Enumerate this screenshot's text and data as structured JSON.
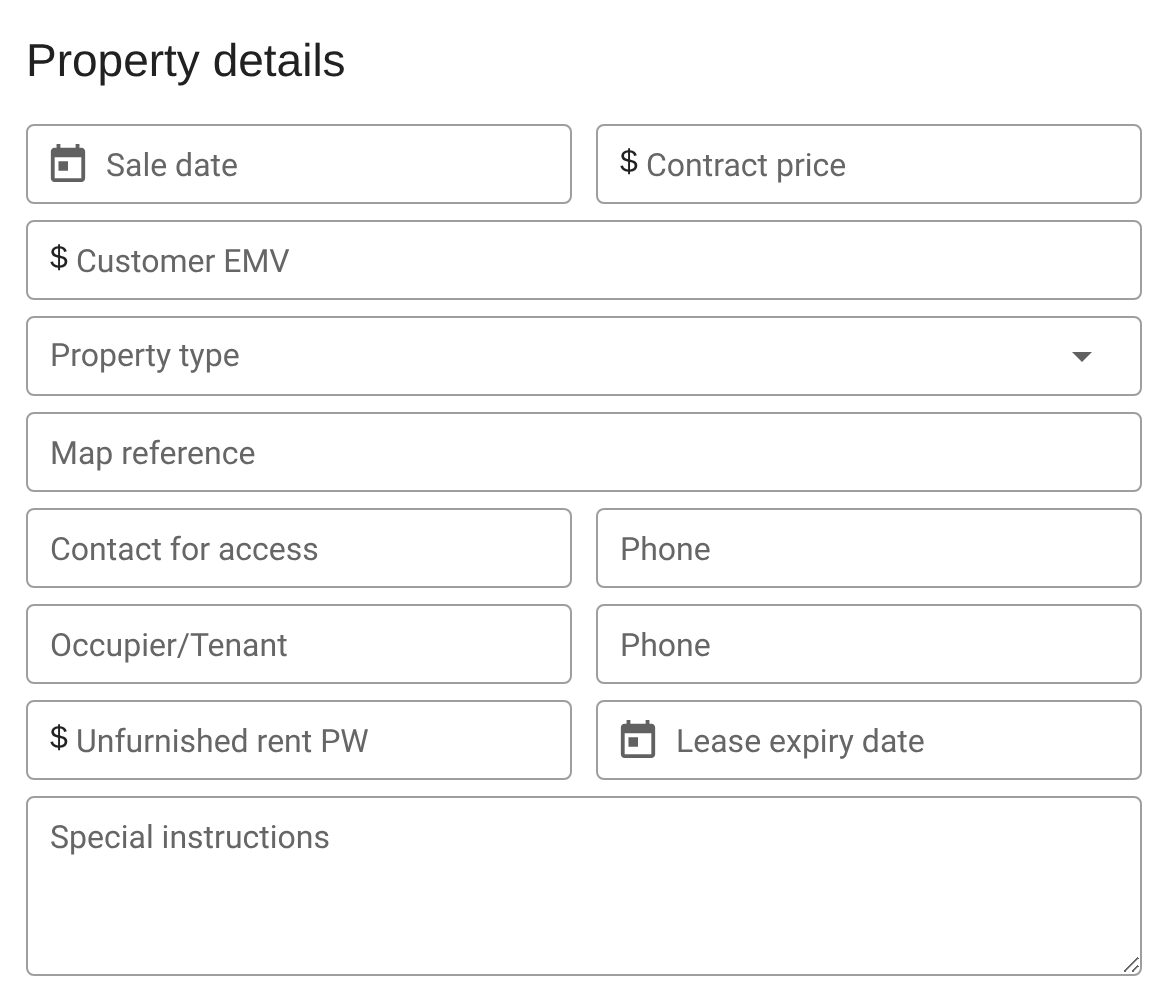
{
  "title": "Property details",
  "rows": [
    {
      "fields": [
        {
          "kind": "date",
          "placeholder": "Sale date"
        },
        {
          "kind": "currency",
          "prefix": "$",
          "placeholder": "Contract price"
        }
      ]
    },
    {
      "fields": [
        {
          "kind": "currency",
          "prefix": "$",
          "placeholder": "Customer EMV"
        }
      ]
    },
    {
      "fields": [
        {
          "kind": "select",
          "placeholder": "Property type"
        }
      ]
    },
    {
      "fields": [
        {
          "kind": "text",
          "placeholder": "Map reference"
        }
      ]
    },
    {
      "fields": [
        {
          "kind": "text",
          "placeholder": "Contact for access"
        },
        {
          "kind": "text",
          "placeholder": "Phone"
        }
      ]
    },
    {
      "fields": [
        {
          "kind": "text",
          "placeholder": "Occupier/Tenant"
        },
        {
          "kind": "text",
          "placeholder": "Phone"
        }
      ]
    },
    {
      "fields": [
        {
          "kind": "currency",
          "prefix": "$",
          "placeholder": "Unfurnished rent PW"
        },
        {
          "kind": "date",
          "placeholder": "Lease expiry date"
        }
      ]
    },
    {
      "fields": [
        {
          "kind": "textarea",
          "placeholder": "Special instructions"
        }
      ]
    }
  ]
}
